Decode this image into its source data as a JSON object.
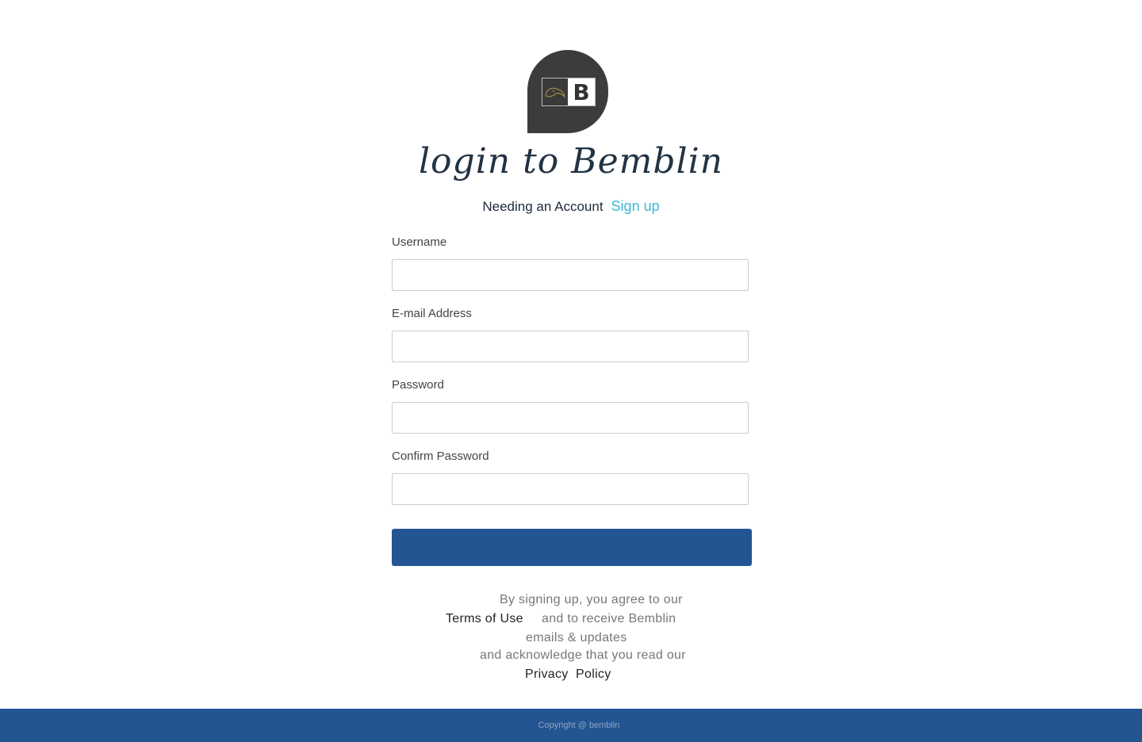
{
  "logo": {
    "letter": "B",
    "icon": "bird-logo-icon",
    "bg_color": "#3c3c3c"
  },
  "title": "login to Bemblin",
  "subline": {
    "text": "Needing an Account",
    "link": "Sign up",
    "link_color": "#3bbad8"
  },
  "form": {
    "fields": [
      {
        "label": "Username",
        "value": ""
      },
      {
        "label": "E-mail Address",
        "value": ""
      },
      {
        "label": "Password",
        "value": ""
      },
      {
        "label": "Confirm Password",
        "value": ""
      }
    ],
    "button_color": "#235592"
  },
  "terms": {
    "line1": "By signing up, you agree to our",
    "terms_link": "Terms of Use",
    "line2": "and to receive Bemblin",
    "line3": "emails & updates",
    "line4": "and acknowledge that you read our",
    "privacy_link": "Privacy  Policy"
  },
  "footer": {
    "copyright": "Copyright @ bemblin"
  }
}
